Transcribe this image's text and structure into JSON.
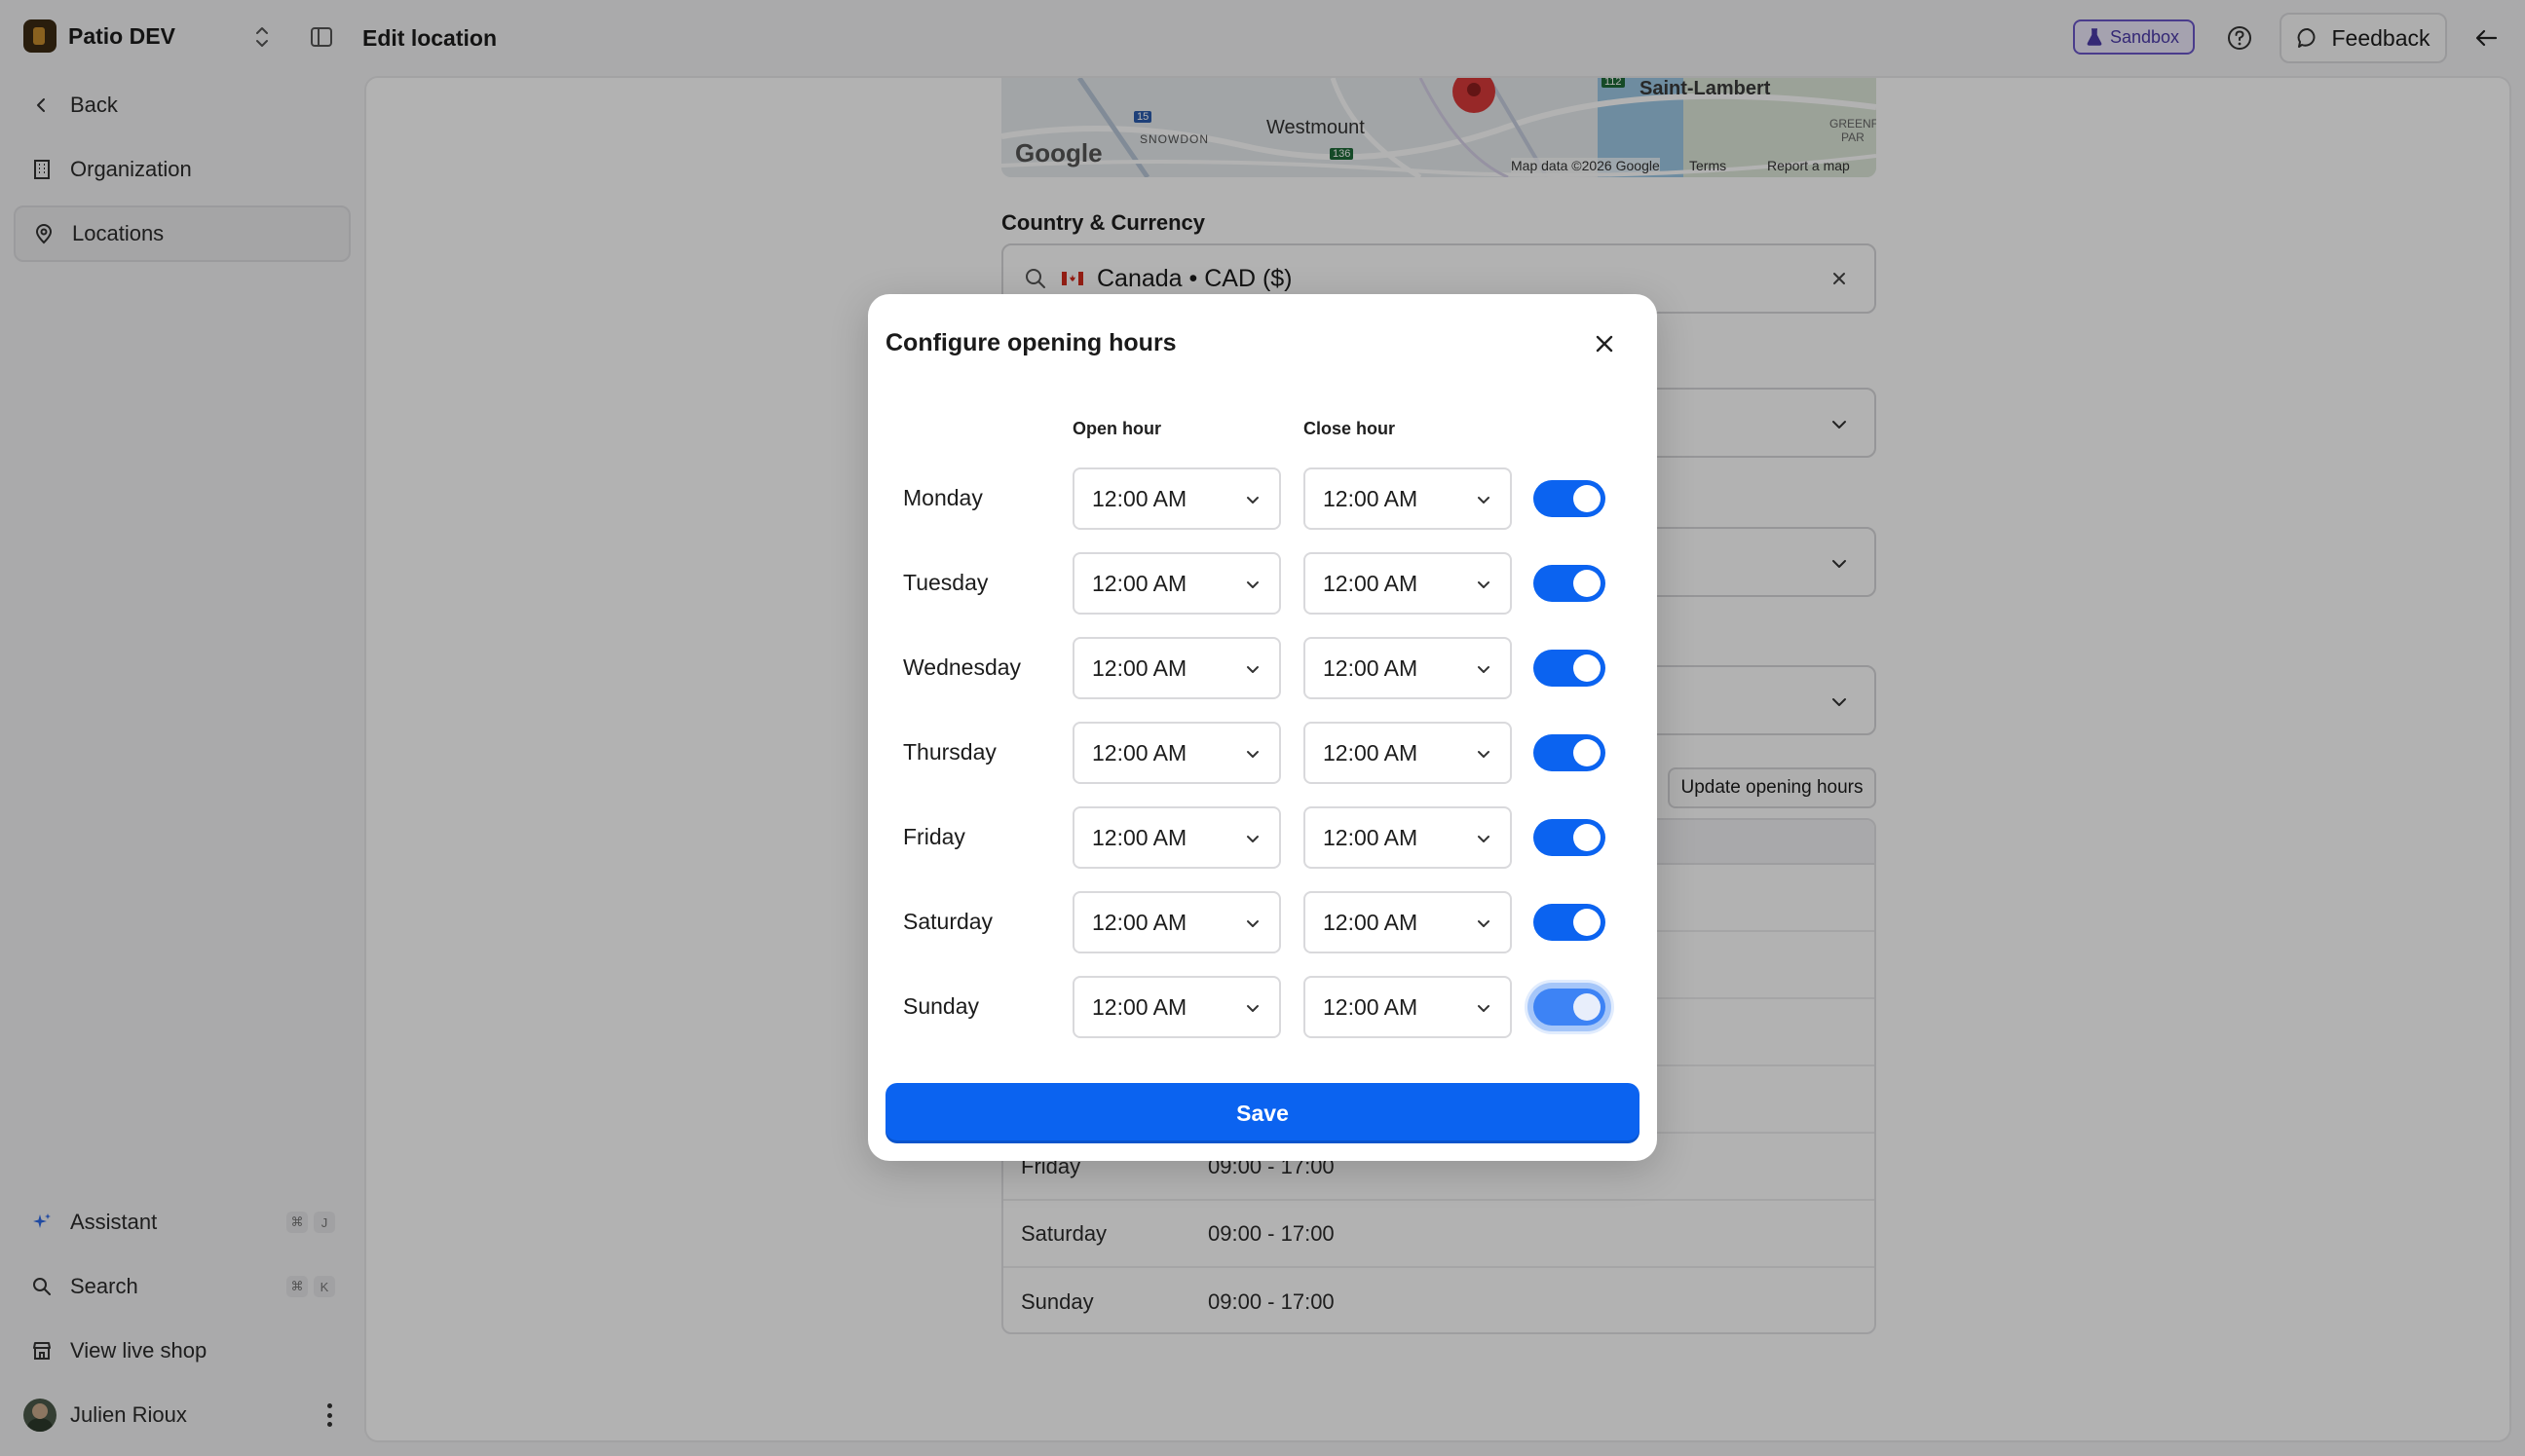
{
  "topbar": {
    "brand_name": "Patio DEV",
    "page_title": "Edit location",
    "sandbox_label": "Sandbox",
    "feedback_label": "Feedback"
  },
  "sidebar": {
    "items": [
      {
        "label": "Back",
        "icon": "chevron-left-icon"
      },
      {
        "label": "Organization",
        "icon": "building-icon"
      },
      {
        "label": "Locations",
        "icon": "location-pin-icon",
        "active": true
      }
    ],
    "bottom_items": [
      {
        "label": "Assistant",
        "icon": "sparkle-icon",
        "shortcut": [
          "⌘",
          "J"
        ]
      },
      {
        "label": "Search",
        "icon": "search-icon",
        "shortcut": [
          "⌘",
          "K"
        ]
      },
      {
        "label": "View live shop",
        "icon": "store-icon"
      }
    ],
    "user": {
      "name": "Julien Rioux"
    }
  },
  "background": {
    "map": {
      "places": [
        "Saint-Lambert",
        "Westmount",
        "SNOWDON",
        "GREENF",
        "PAR"
      ],
      "route_badges": [
        "15",
        "136",
        "112"
      ],
      "google_label": "Google",
      "attribution": "Map data ©2026 Google",
      "terms": "Terms",
      "report": "Report a map error"
    },
    "country_currency_label": "Country & Currency",
    "country_value": "Canada • CAD ($)",
    "update_hours_label": "Update opening hours",
    "hours_rows": [
      {
        "day": "Friday",
        "hours": "09:00 - 17:00"
      },
      {
        "day": "Saturday",
        "hours": "09:00 - 17:00"
      },
      {
        "day": "Sunday",
        "hours": "09:00 - 17:00"
      }
    ]
  },
  "modal": {
    "title": "Configure opening hours",
    "open_hour_header": "Open hour",
    "close_hour_header": "Close hour",
    "days": [
      {
        "day": "Monday",
        "open": "12:00 AM",
        "close": "12:00 AM",
        "enabled": true
      },
      {
        "day": "Tuesday",
        "open": "12:00 AM",
        "close": "12:00 AM",
        "enabled": true
      },
      {
        "day": "Wednesday",
        "open": "12:00 AM",
        "close": "12:00 AM",
        "enabled": true
      },
      {
        "day": "Thursday",
        "open": "12:00 AM",
        "close": "12:00 AM",
        "enabled": true
      },
      {
        "day": "Friday",
        "open": "12:00 AM",
        "close": "12:00 AM",
        "enabled": true
      },
      {
        "day": "Saturday",
        "open": "12:00 AM",
        "close": "12:00 AM",
        "enabled": true
      },
      {
        "day": "Sunday",
        "open": "12:00 AM",
        "close": "12:00 AM",
        "enabled": true,
        "focused": true
      }
    ],
    "save_label": "Save"
  },
  "colors": {
    "accent": "#0b63f0",
    "sandbox_border": "#6b57c9"
  }
}
